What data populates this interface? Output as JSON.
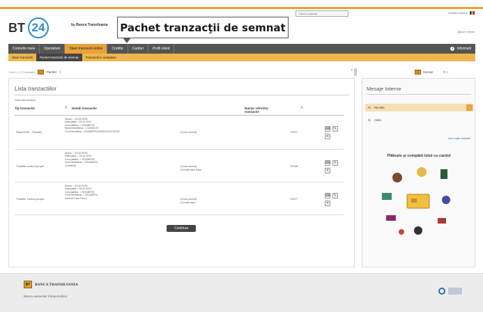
{
  "header": {
    "logo_bt": "BT",
    "logo_num": "24",
    "bank_name": "by Banca Transilvania",
    "user_box": "Client cunoscut",
    "top_right": "Inchide sesiune",
    "top_links": "Ajutor | Home"
  },
  "callout": "Pachet tranzacţii de semnat",
  "main_nav": {
    "items": [
      "Conturile mele",
      "Operatiuni",
      "Stare tranzactii online",
      "Credite",
      "Carduri",
      "Profil client"
    ],
    "active_index": 2,
    "right": "Informatii"
  },
  "sub_nav": {
    "items": [
      "Stare tranzactii",
      "Pachet tranzactii de semnat",
      "Tranzactii in asteptare"
    ],
    "active_index": 1
  },
  "toolbar": {
    "left_text": "1 din 1 | 2 | Tranzactii",
    "active_tab": "Pachet",
    "close_mark": "x"
  },
  "panel": {
    "title": "Lista tranzactiilor",
    "lista_label": "Lista tranzactiilor",
    "columns": [
      "Tip tranzactie",
      "Detalii tranzactie",
      "Numar referinta tranzactie"
    ],
    "rows": [
      {
        "type": "Plata RON - Transfer",
        "details": [
          "Suma: = 10.00 RON",
          "Data plata = 18.10.2011",
          "Cont platitor: = RO18BTRL",
          "Nume beneficiar = COSMOTE",
          "Cont beneficiar = RO34BTRL0000010113731000"
        ],
        "cont": "(Cont curent)",
        "cont2": "",
        "num": "70371"
      },
      {
        "type": "Transfer conturi proprii",
        "details": [
          "Suma: = 20.00 RON",
          "Data plata = 18.10.2011",
          "Cont platitor: = RO18BTRL",
          "Cont beneficiar: = RO44BTRL",
          "Comision)"
        ],
        "cont": "(Cont curent)",
        "cont2": "(Credit card Visa",
        "num": "70768"
      },
      {
        "type": "Transfer conturi proprii",
        "details": [
          "Suma: = 10.00 RON",
          "Data plata = 18.10.2011",
          "Cont platitor: = RO18BTRL",
          "Cont beneficiar: = RO15BTRL",
          "Internet Card Forte)"
        ],
        "cont": "(Cont curent)",
        "cont2": "(Credit card",
        "num": "70477"
      }
    ],
    "continue_button": "Continua"
  },
  "right_panel": {
    "tab_label": "Mesaje",
    "title": "Mesaje Interne",
    "rows": [
      {
        "label": "Necitite",
        "badge": "1"
      },
      {
        "label": "Citite",
        "badge": ""
      }
    ],
    "link": "Vezi toate detaliile",
    "promo_title": "Plăteşte şi cumpără totul cu cardul"
  },
  "footer": {
    "bank_name": "BANCA TRANSILVANIA",
    "slogan": "Banca oamenilor întreprinzători"
  },
  "colors": {
    "accent": "#e8a13a",
    "nav_bg": "#555555",
    "subnav_bg": "#f0b64d",
    "link": "#2a6fb0"
  }
}
